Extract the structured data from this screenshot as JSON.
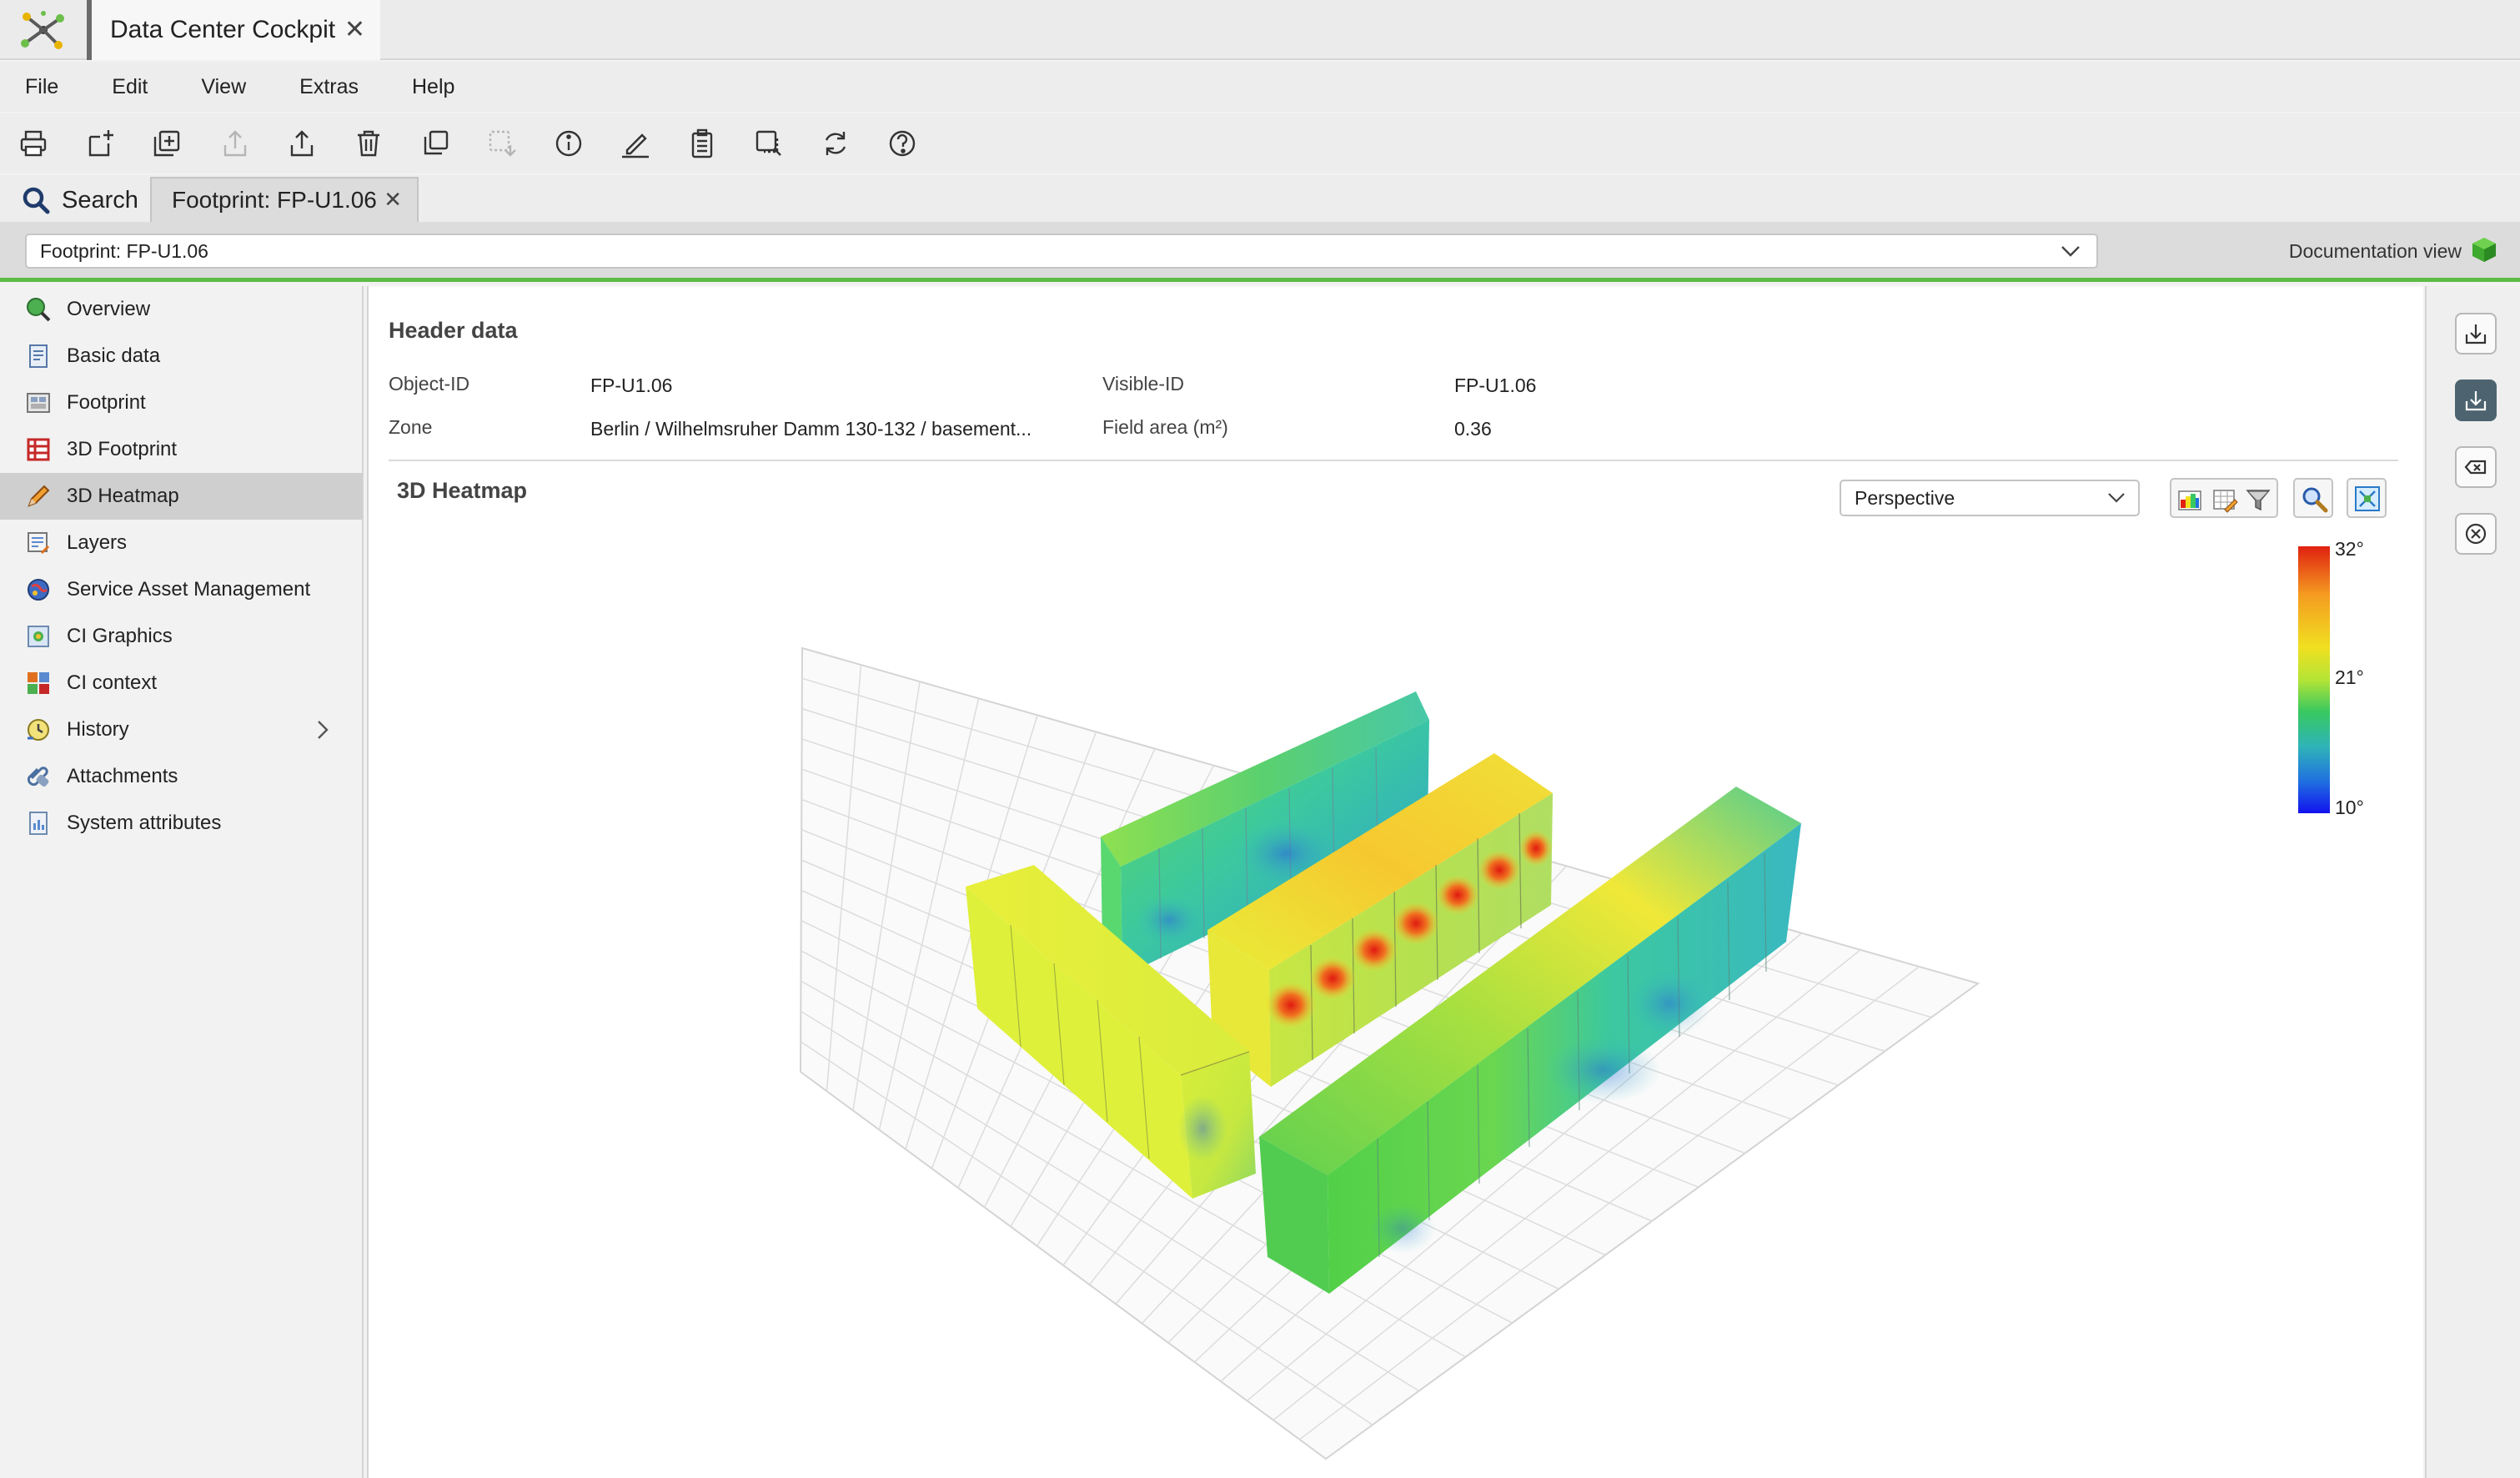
{
  "app": {
    "title": "Data Center Cockpit",
    "close_icon": "close-icon"
  },
  "menu": [
    "File",
    "Edit",
    "View",
    "Extras",
    "Help"
  ],
  "toolbar_icons": [
    "print-icon",
    "new-icon",
    "new-copy-icon",
    "export-disabled-icon",
    "export-icon",
    "delete-icon",
    "copy-icon",
    "paste-disabled-icon",
    "info-icon",
    "edit-icon",
    "clipboard-icon",
    "select-icon",
    "refresh-icon",
    "help-icon"
  ],
  "tabs": {
    "search": "Search",
    "doc": "Footprint: FP-U1.06"
  },
  "selector": {
    "value": "Footprint: FP-U1.06",
    "documentation_view": "Documentation view"
  },
  "nav": [
    {
      "label": "Overview",
      "icon": "overview-icon"
    },
    {
      "label": "Basic data",
      "icon": "document-icon"
    },
    {
      "label": "Footprint",
      "icon": "footprint-icon"
    },
    {
      "label": "3D Footprint",
      "icon": "3d-footprint-icon"
    },
    {
      "label": "3D Heatmap",
      "icon": "pencil-icon",
      "active": true
    },
    {
      "label": "Layers",
      "icon": "layers-icon"
    },
    {
      "label": "Service Asset Management",
      "icon": "globe-icon"
    },
    {
      "label": "CI Graphics",
      "icon": "ci-graphics-icon"
    },
    {
      "label": "CI context",
      "icon": "ci-context-icon"
    },
    {
      "label": "History",
      "icon": "history-icon",
      "has_submenu": true
    },
    {
      "label": "Attachments",
      "icon": "attachment-icon"
    },
    {
      "label": "System attributes",
      "icon": "system-attributes-icon"
    }
  ],
  "header": {
    "title": "Header data",
    "object_id_label": "Object-ID",
    "object_id": "FP-U1.06",
    "visible_id_label": "Visible-ID",
    "visible_id": "FP-U1.06",
    "zone_label": "Zone",
    "zone": "Berlin / Wilhelmsruher Damm 130-132 / basement...",
    "field_area_label": "Field area (m²)",
    "field_area": "0.36"
  },
  "heatmap": {
    "title": "3D Heatmap",
    "projection": "Perspective",
    "legend": {
      "max": "32°",
      "mid": "21°",
      "min": "10°"
    },
    "colors": {
      "cold": "#1212ee",
      "cool": "#2fb4b8",
      "mid": "#38c860",
      "warm": "#f0e020",
      "hot": "#e02010"
    }
  },
  "rail_icons": [
    "download-icon",
    "download-active-icon",
    "clear-icon",
    "close-circle-icon"
  ]
}
